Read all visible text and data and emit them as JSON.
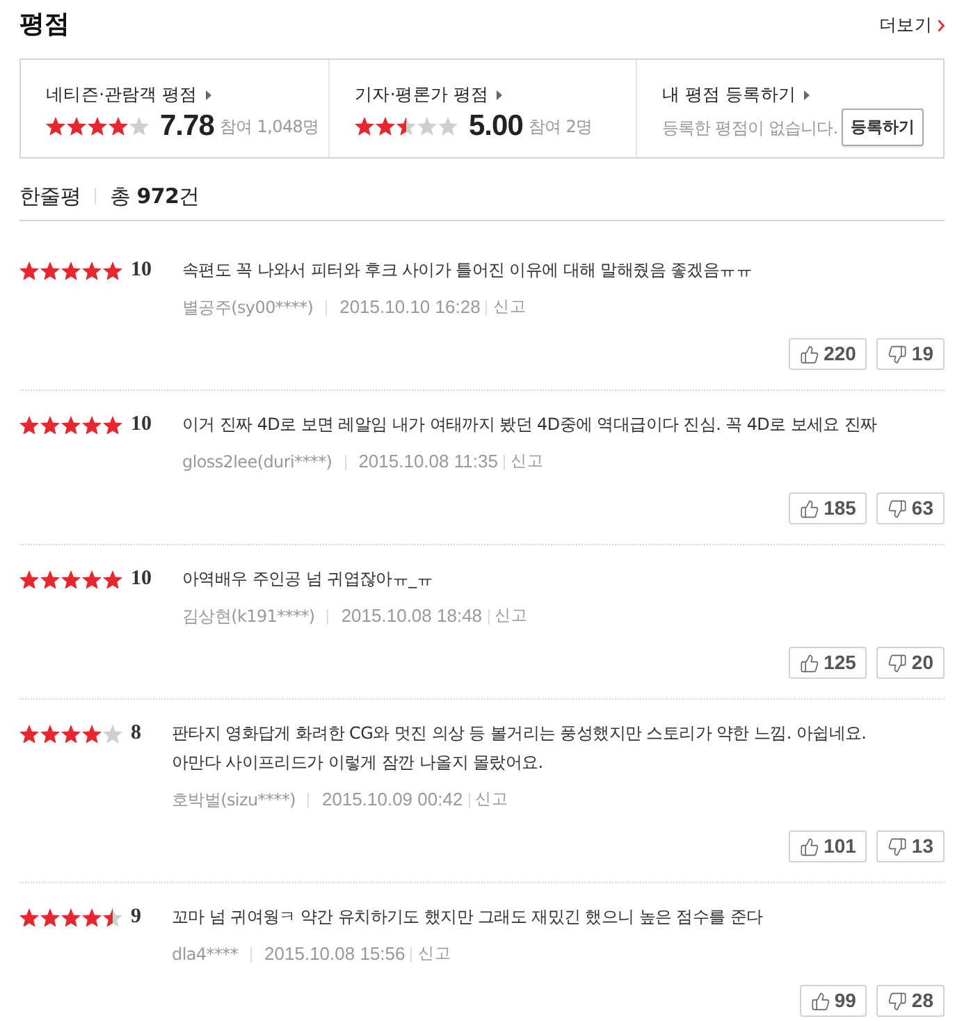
{
  "section": {
    "title": "평점",
    "more_link": "더보기"
  },
  "summary": [
    {
      "kind": "rating",
      "label": "네티즌·관람객 평점",
      "stars": 4,
      "score": "7.78",
      "participants": "참여 1,048명"
    },
    {
      "kind": "rating",
      "label": "기자·평론가 평점",
      "stars": 2.5,
      "score": "5.00",
      "participants": "참여 2명"
    },
    {
      "kind": "register",
      "label": "내 평점 등록하기",
      "message": "등록한 평점이 없습니다.",
      "button": "등록하기"
    }
  ],
  "comments_header": {
    "title": "한줄평",
    "total": "총 **972**건"
  },
  "reviews": [
    {
      "stars": 5,
      "score": "10",
      "text": "속편도 꼭 나와서 피터와 후크 사이가 틀어진 이유에 대해 말해줬음 좋겠음ㅠㅠ",
      "author": "별공주(sy00****)",
      "date": "2015.10.10 16:28",
      "report": "신고",
      "likes": "220",
      "dislikes": "19"
    },
    {
      "stars": 5,
      "score": "10",
      "text": "이거 진짜 4D로 보면 레알임 내가 여태까지 봤던 4D중에 역대급이다 진심. 꼭 4D로 보세요 진짜",
      "author": "gloss2lee(duri****)",
      "date": "2015.10.08 11:35",
      "report": "신고",
      "likes": "185",
      "dislikes": "63"
    },
    {
      "stars": 5,
      "score": "10",
      "text": "아역배우 주인공 넘 귀엽잖아ㅠ_ㅠ",
      "author": "김상현(k191****)",
      "date": "2015.10.08 18:48",
      "report": "신고",
      "likes": "125",
      "dislikes": "20"
    },
    {
      "stars": 4,
      "score": "8",
      "text": "판타지 영화답게 화려한 CG와 멋진 의상 등 볼거리는 풍성했지만 스토리가 약한 느낌. 아쉽네요.\n아만다 사이프리드가 이렇게 잠깐 나올지 몰랐어요.",
      "author": "호박벌(sizu****)",
      "date": "2015.10.09 00:42",
      "report": "신고",
      "likes": "101",
      "dislikes": "13"
    },
    {
      "stars": 4.5,
      "score": "9",
      "text": "꼬마 넘 귀여웡ㅋ 약간 유치하기도 했지만 그래도 재밌긴 했으니 높은 점수를 준다",
      "author": "dla4****",
      "date": "2015.10.08 15:56",
      "report": "신고",
      "likes": "99",
      "dislikes": "28"
    }
  ]
}
